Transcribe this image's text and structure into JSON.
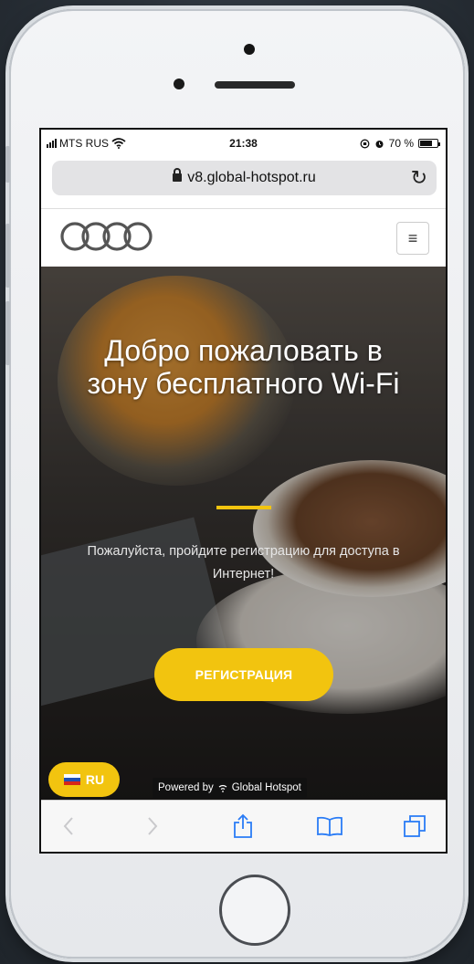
{
  "status_bar": {
    "carrier": "MTS RUS",
    "time": "21:38",
    "battery_text": "70 %",
    "battery_level": 0.7
  },
  "browser": {
    "url": "v8.global-hotspot.ru",
    "icons": [
      "lock-icon",
      "reload-icon",
      "back-icon",
      "forward-icon",
      "share-icon",
      "bookmarks-icon",
      "tabs-icon"
    ]
  },
  "site_header": {
    "logo": "audi-rings-logo",
    "menu_icon": "≡"
  },
  "hero": {
    "title": "Добро пожаловать в зону бесплатного Wi-Fi",
    "subtitle": "Пожалуйста, пройдите регистрацию для доступа в Интернет!",
    "register_button": "РЕГИСТРАЦИЯ",
    "accent_color": "#f2c40f"
  },
  "language": {
    "label": "RU"
  },
  "powered_by": {
    "prefix": "Powered by",
    "brand": "Global Hotspot"
  }
}
